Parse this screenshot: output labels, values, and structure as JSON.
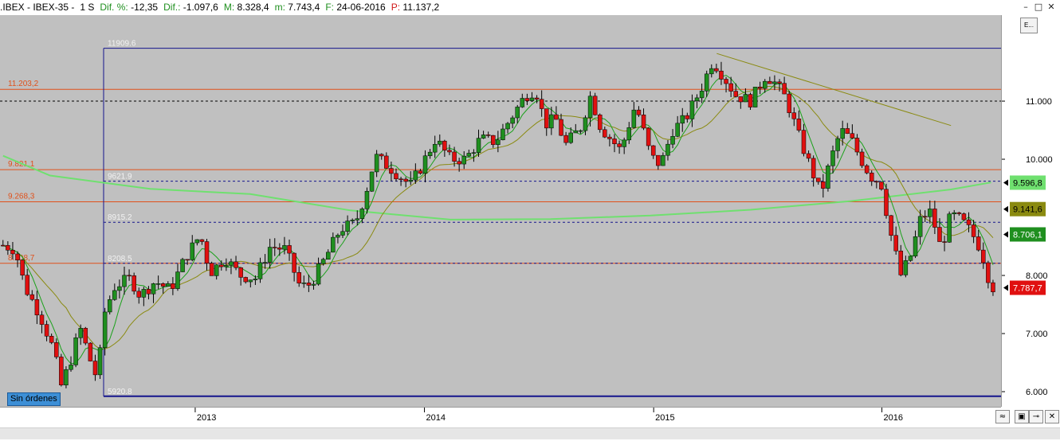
{
  "header": {
    "symbol": ".IBEX - IBEX-35 -",
    "period": "1 S",
    "dif_pct_label": "Dif. %:",
    "dif_pct_value": "-12,35",
    "dif_label": "Dif.:",
    "dif_value": "-1.097,6",
    "max_label": "M:",
    "max_value": "8.328,4",
    "min_label": "m:",
    "min_value": "7.743,4",
    "date_label": "F:",
    "date_value": "24-06-2016",
    "prev_label": "P:",
    "prev_value": "11.137,2",
    "window_buttons": [
      "–",
      "□",
      "✕"
    ]
  },
  "side_button_label": "E...",
  "status_badge": "Sin órdenes",
  "colors": {
    "up_candle": "#1f8f1f",
    "down_candle": "#e01010",
    "level_line": "#e0501a",
    "fib_line": "#14148c",
    "ma_fast": "#1aa11a",
    "ma_mid": "#8a8a10",
    "ma_slow": "#6fe06f"
  },
  "chart_data": {
    "type": "candlestick",
    "title": "",
    "x_ticks": [
      "2013",
      "2014",
      "2015",
      "2016"
    ],
    "y_ticks": [
      "6.000",
      "7.000",
      "8.000",
      "10.000",
      "11.000"
    ],
    "ylim": [
      5740,
      12480
    ],
    "grid": false,
    "horizontal_levels": [
      {
        "label": "11.203,2",
        "value": 11203.2,
        "style": "solid"
      },
      {
        "label": "9.821,1",
        "value": 9821.1,
        "style": "solid"
      },
      {
        "label": "9.268,3",
        "value": 9268.3,
        "style": "solid"
      },
      {
        "label": "8.208,7",
        "value": 8208.7,
        "style": "solid"
      }
    ],
    "fib_levels": [
      {
        "label": "11909.6",
        "value": 11909.6
      },
      {
        "label": "9621.9",
        "value": 9621.9
      },
      {
        "label": "8915.2",
        "value": 8915.2
      },
      {
        "label": "8208.5",
        "value": 8208.5
      },
      {
        "label": "5920.8",
        "value": 5920.8
      }
    ],
    "reference_level": 11000,
    "price_tags": [
      {
        "label": "9.596,8",
        "value": 9596.8,
        "bg": "#6fe06f",
        "fg": "#000000"
      },
      {
        "label": "9.141,6",
        "value": 9141.6,
        "bg": "#8a8a10",
        "fg": "#000000"
      },
      {
        "label": "8.706,1",
        "value": 8706.1,
        "bg": "#1f8f1f",
        "fg": "#ffffff"
      },
      {
        "label": "7.787,7",
        "value": 7787.7,
        "bg": "#e01010",
        "fg": "#ffffff"
      }
    ],
    "trendline": {
      "start": [
        0.716,
        11820
      ],
      "end": [
        0.95,
        10580
      ]
    },
    "close_series": [
      [
        0.003,
        8520
      ],
      [
        0.015,
        8450
      ],
      [
        0.025,
        7800
      ],
      [
        0.04,
        7320
      ],
      [
        0.055,
        6650
      ],
      [
        0.06,
        6050
      ],
      [
        0.07,
        6500
      ],
      [
        0.08,
        7100
      ],
      [
        0.09,
        6550
      ],
      [
        0.097,
        6220
      ],
      [
        0.105,
        7400
      ],
      [
        0.115,
        7820
      ],
      [
        0.13,
        7950
      ],
      [
        0.14,
        7650
      ],
      [
        0.155,
        7900
      ],
      [
        0.17,
        7750
      ],
      [
        0.185,
        8300
      ],
      [
        0.2,
        8700
      ],
      [
        0.21,
        8050
      ],
      [
        0.225,
        8300
      ],
      [
        0.24,
        8000
      ],
      [
        0.255,
        7950
      ],
      [
        0.27,
        8500
      ],
      [
        0.285,
        8450
      ],
      [
        0.3,
        7800
      ],
      [
        0.31,
        7850
      ],
      [
        0.325,
        8300
      ],
      [
        0.34,
        8800
      ],
      [
        0.355,
        8900
      ],
      [
        0.365,
        9400
      ],
      [
        0.375,
        10050
      ],
      [
        0.39,
        9850
      ],
      [
        0.41,
        9550
      ],
      [
        0.42,
        9850
      ],
      [
        0.435,
        10350
      ],
      [
        0.45,
        10000
      ],
      [
        0.465,
        10000
      ],
      [
        0.48,
        10350
      ],
      [
        0.495,
        10300
      ],
      [
        0.51,
        10700
      ],
      [
        0.525,
        11100
      ],
      [
        0.535,
        11200
      ],
      [
        0.545,
        10600
      ],
      [
        0.555,
        10700
      ],
      [
        0.565,
        10250
      ],
      [
        0.58,
        10550
      ],
      [
        0.59,
        11100
      ],
      [
        0.6,
        10550
      ],
      [
        0.61,
        10350
      ],
      [
        0.62,
        10150
      ],
      [
        0.635,
        10950
      ],
      [
        0.65,
        10050
      ],
      [
        0.66,
        9900
      ],
      [
        0.672,
        10500
      ],
      [
        0.685,
        10700
      ],
      [
        0.7,
        11200
      ],
      [
        0.712,
        11700
      ],
      [
        0.72,
        11500
      ],
      [
        0.735,
        11100
      ],
      [
        0.75,
        11000
      ],
      [
        0.765,
        11450
      ],
      [
        0.775,
        11300
      ],
      [
        0.785,
        11050
      ],
      [
        0.8,
        10300
      ],
      [
        0.81,
        9850
      ],
      [
        0.82,
        9400
      ],
      [
        0.83,
        10000
      ],
      [
        0.84,
        10500
      ],
      [
        0.85,
        10350
      ],
      [
        0.86,
        10000
      ],
      [
        0.87,
        9700
      ],
      [
        0.88,
        9600
      ],
      [
        0.89,
        8700
      ],
      [
        0.9,
        8000
      ],
      [
        0.91,
        8350
      ],
      [
        0.92,
        9000
      ],
      [
        0.93,
        9100
      ],
      [
        0.94,
        8450
      ],
      [
        0.95,
        9050
      ],
      [
        0.96,
        8950
      ],
      [
        0.97,
        8750
      ],
      [
        0.98,
        8450
      ],
      [
        0.99,
        7800
      ]
    ]
  }
}
